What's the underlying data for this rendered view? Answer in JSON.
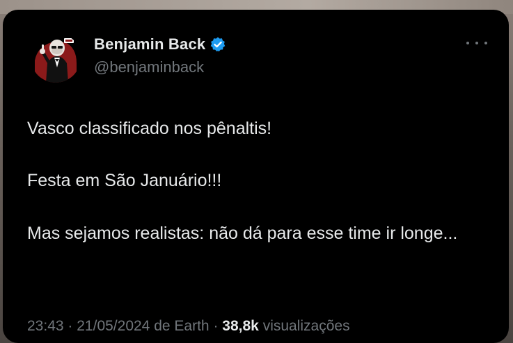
{
  "tweet": {
    "author_name": "Benjamin Back",
    "author_handle": "@benjaminback",
    "verified": true,
    "paragraphs": [
      "Vasco classificado nos pênaltis!",
      "Festa em São Januário!!!",
      "Mas sejamos realistas: não dá para esse time ir longe..."
    ],
    "time": "23:43",
    "separator": "·",
    "date": "21/05/2024",
    "source": "de Earth",
    "views_count": "38,8k",
    "views_label": "visualizações"
  },
  "colors": {
    "card_background": "#000000",
    "text_primary": "#e7e9ea",
    "text_secondary": "#71767b",
    "verified_badge": "#1d9bf0"
  },
  "icons": {
    "verified": "verified-badge-icon",
    "more": "more-options-icon"
  }
}
